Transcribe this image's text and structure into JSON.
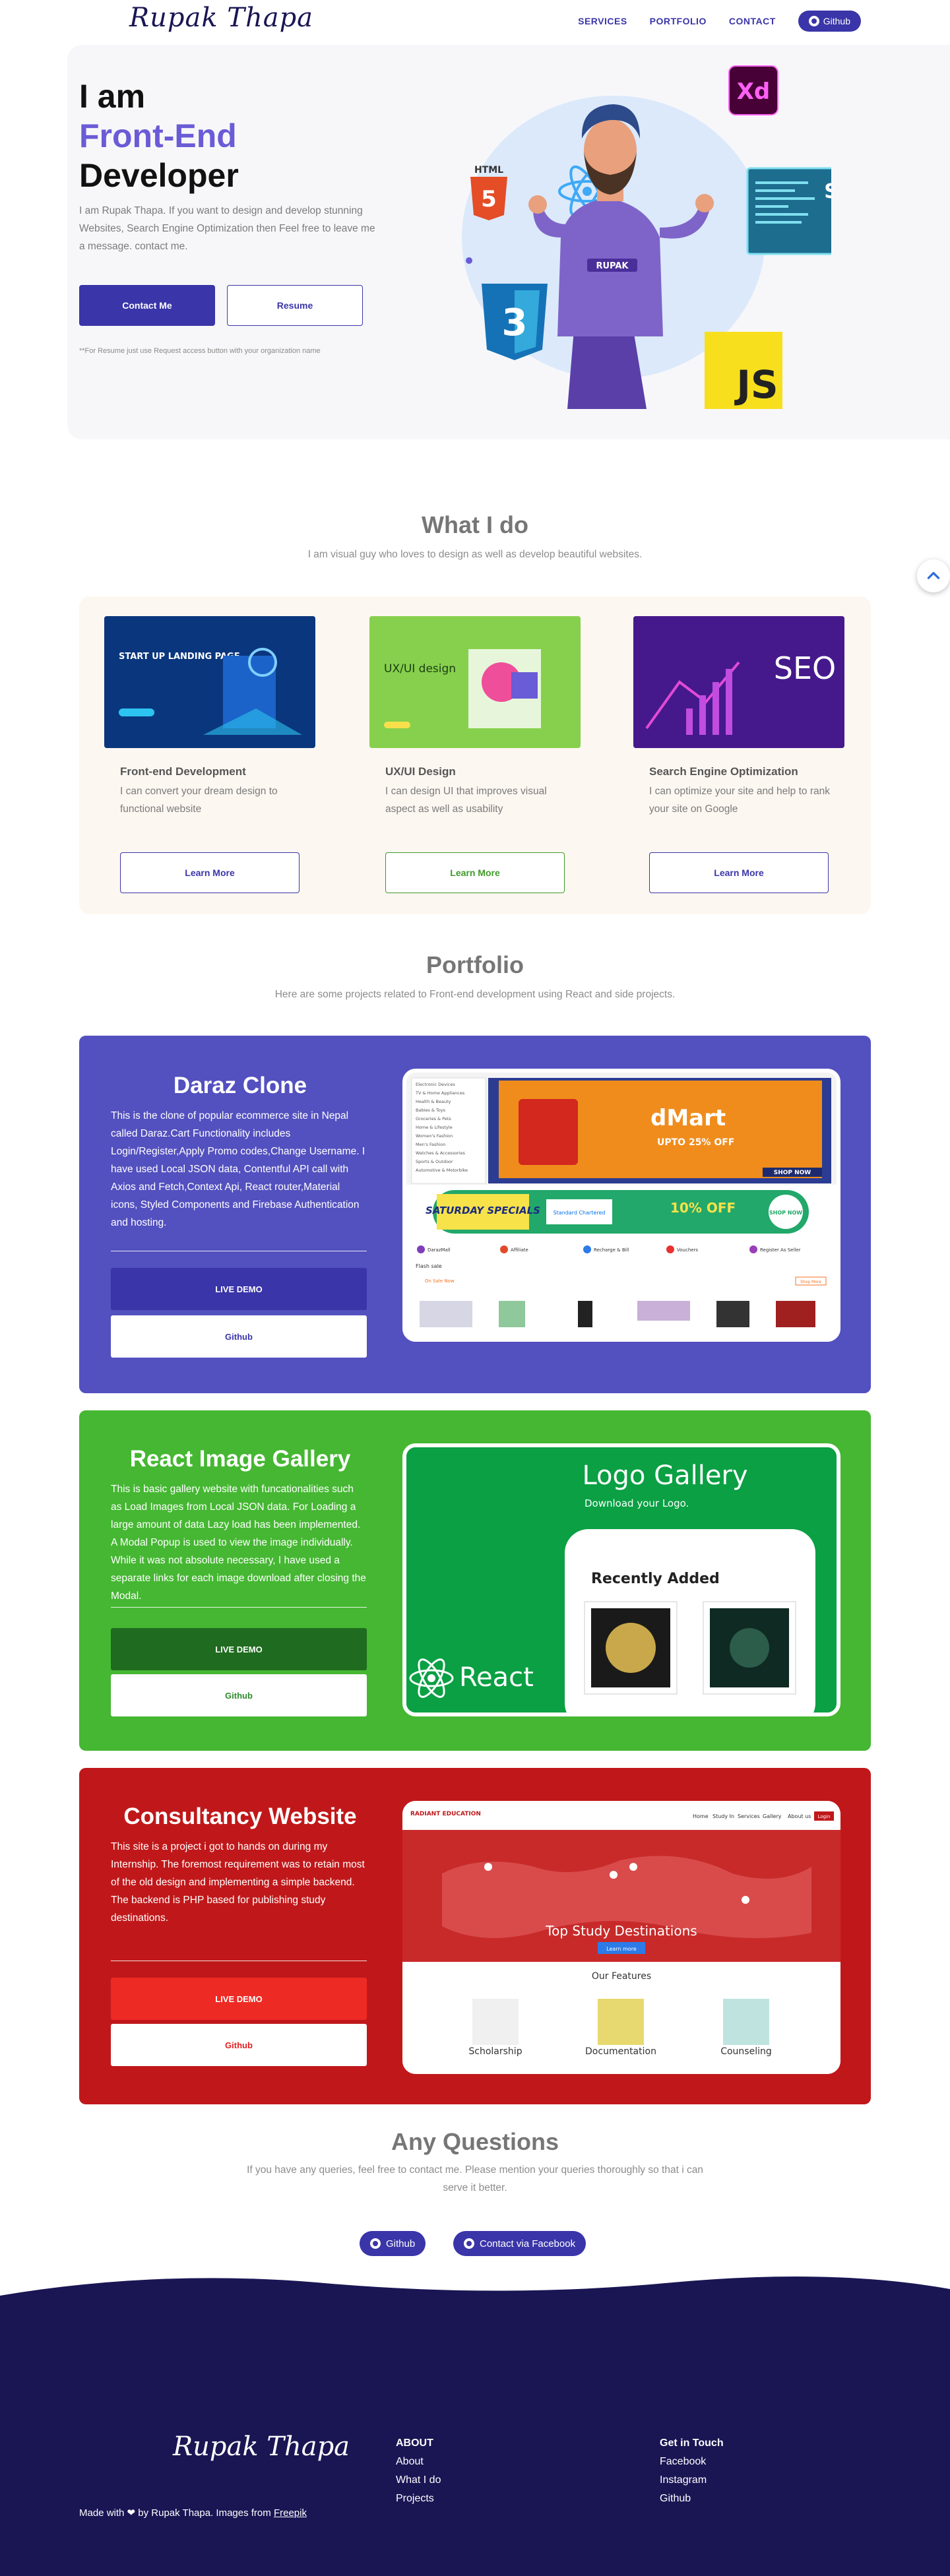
{
  "nav": {
    "logo": "Rupak Thapa",
    "links": [
      "SERVICES",
      "PORTFOLIO",
      "CONTACT"
    ],
    "github": "Github"
  },
  "hero": {
    "line1": "I am",
    "line2": "Front-End",
    "line3": "Developer",
    "description": "I am Rupak Thapa. If you want to design and develop stunning Websites, Search Engine Optimization then Feel free to leave me a message. contact me.",
    "contact_button": "Contact Me",
    "resume_button": "Resume",
    "note": "**For Resume just use Request access button with your organization name",
    "art": {
      "badge_html": "HTML",
      "badge_html_num": "5",
      "badge_xd": "Xd",
      "badge_seo": "SEO",
      "badge_js": "JS",
      "shirt_text": "RUPAK"
    }
  },
  "what_i_do": {
    "title": "What I do",
    "subtitle": "I am visual guy who loves to design as well as develop beautiful websites.",
    "services": [
      {
        "title": "Front-end Development",
        "description": "I can convert your dream design to functional website",
        "button": "Learn More",
        "color": "#3a35a8",
        "img_text": "START UP LANDING PAGE"
      },
      {
        "title": "UX/UI Design",
        "description": "I can design UI that improves visual aspect as well as usability",
        "button": "Learn More",
        "color": "#3f9a2a",
        "img_text": "UX/UI design"
      },
      {
        "title": "Search Engine Optimization",
        "description": "I can optimize your site and help to rank your site on Google",
        "button": "Learn More",
        "color": "#3a35a8",
        "img_text": "SEO"
      }
    ]
  },
  "portfolio": {
    "title": "Portfolio",
    "subtitle": "Here are some projects related to Front-end development using React and side projects.",
    "projects": [
      {
        "title": "Daraz Clone",
        "description": "This is the clone of popular ecommerce site in Nepal called Daraz.Cart Functionality includes Login/Register,Apply Promo codes,Change Username. I have used Local JSON data, Contentful API call with Axios and Fetch,Context Api, React router,Material icons, Styled Components and Firebase Authentication and hosting.",
        "live": "LIVE DEMO",
        "github": "Github",
        "bg": "#5350bf",
        "live_bg": "#3a35a8",
        "gh_color": "#3a35a8",
        "shot": {
          "banner": "dMart",
          "banner_sub": "UPTO 25% OFF",
          "shop_now": "SHOP NOW",
          "promo": "SATURDAY SPECIALS",
          "promo_bank": "Standard Chartered",
          "promo_off": "10% OFF",
          "promo_shop": "SHOP NOW",
          "categories": [
            "DarazMall",
            "Affiliate",
            "Recharge & Bill",
            "Vouchers",
            "Register As Seller"
          ],
          "flash": "Flash sale",
          "on_sale": "On Sale Now",
          "shop_more": "Shop More",
          "sidebar": [
            "Electronic Devices",
            "TV & Home Appliances",
            "Health & Beauty",
            "Babies & Toys",
            "Groceries & Pets",
            "Home & Lifestyle",
            "Women's Fashion",
            "Men's Fashion",
            "Watches & Accessories",
            "Sports & Outdoor",
            "Automotive & Motorbike"
          ]
        }
      },
      {
        "title": "React Image Gallery",
        "description": "This is basic gallery website with funcationalities such as Load Images from Local JSON data. For Loading a large amount of data Lazy load has been implemented. A Modal Popup is used to view the image individually. While it was not absolute necessary, I have used a separate links for each image download after closing the Modal.",
        "live": "LIVE DEMO",
        "github": "Github",
        "bg": "#45b732",
        "live_bg": "#1f6b1f",
        "gh_color": "#2f8a2f",
        "shot": {
          "heading": "Logo Gallery",
          "subheading": "Download your Logo.",
          "card_title": "Recently Added",
          "react": "React"
        }
      },
      {
        "title": "Consultancy Website",
        "description": "This site is a project i got to hands on during my Internship. The foremost requirement was to retain most of the old design and implementing a simple backend. The backend is PHP based for publishing study destinations.",
        "live": "LIVE DEMO",
        "github": "Github",
        "bg": "#c0181a",
        "live_bg": "#ee2a24",
        "gh_color": "#e02020",
        "shot": {
          "brand": "RADIANT EDUCATION",
          "nav": [
            "Home",
            "Study In",
            "Services",
            "Gallery",
            "About us"
          ],
          "login": "Login",
          "hero": "Top Study Destinations",
          "hero_btn": "Learn more",
          "features": "Our Features",
          "feature_items": [
            "Scholarship",
            "Documentation",
            "Counseling"
          ]
        }
      }
    ]
  },
  "questions": {
    "title": "Any Questions",
    "text": "If you have any queries, feel free to contact me. Please mention your queries thoroughly so that i can serve it better.",
    "github": "Github",
    "facebook": "Contact via Facebook"
  },
  "footer": {
    "logo": "Rupak Thapa",
    "about_heading": "ABOUT",
    "about_links": [
      "About",
      "What I do",
      "Projects"
    ],
    "touch_heading": "Get in Touch",
    "touch_links": [
      "Facebook",
      "Instagram",
      "Github"
    ],
    "copyright": "Made with ❤ by Rupak Thapa. Images from",
    "freepik": "Freepik",
    "bg": "#1a1654"
  }
}
